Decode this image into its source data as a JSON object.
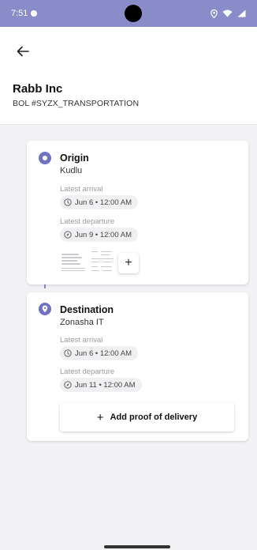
{
  "status_bar": {
    "time": "7:51",
    "right_icons": [
      "location-icon",
      "wifi-icon",
      "signal-icon"
    ]
  },
  "header": {
    "title": "Rabb Inc",
    "subtitle": "BOL #SYZX_TRANSPORTATION"
  },
  "origin": {
    "title": "Origin",
    "place": "Kudlu",
    "arrival_label": "Latest arrival",
    "arrival_value": "Jun 6 • 12:00 AM",
    "departure_label": "Latest departure",
    "departure_value": "Jun 9 • 12:00 AM",
    "add_document_label": "+"
  },
  "destination": {
    "title": "Destination",
    "place": "Zonasha IT",
    "arrival_label": "Latest arrival",
    "arrival_value": "Jun 6 • 12:00 AM",
    "departure_label": "Latest departure",
    "departure_value": "Jun 11 • 12:00 AM",
    "proof_button_plus": "+",
    "proof_button_label": "Add proof of delivery"
  },
  "colors": {
    "accent": "#6f72c2",
    "status_bar": "#8a8cc9",
    "background": "#f2f2f5"
  }
}
